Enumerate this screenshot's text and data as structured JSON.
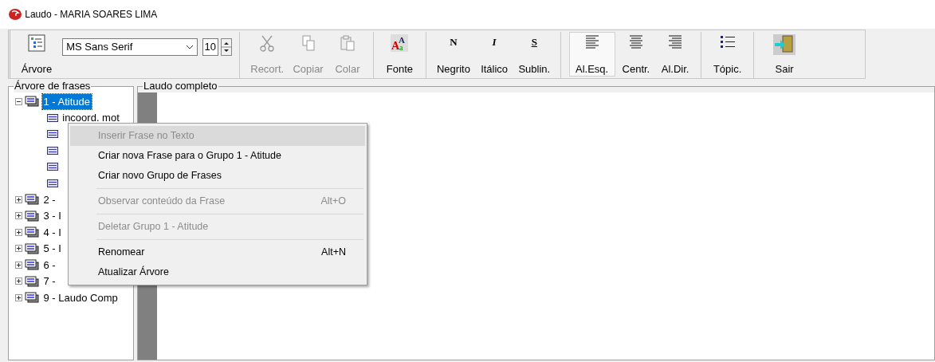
{
  "window": {
    "title": "Laudo - MARIA SOARES LIMA"
  },
  "toolbar": {
    "items": [
      {
        "kind": "button",
        "label": "Árvore"
      },
      {
        "kind": "font",
        "value": "MS Sans Serif",
        "size": "10"
      },
      {
        "kind": "separator"
      },
      {
        "kind": "button",
        "label": "Recort.",
        "disabled": true
      },
      {
        "kind": "button",
        "label": "Copiar",
        "disabled": true
      },
      {
        "kind": "button",
        "label": "Colar",
        "disabled": true
      },
      {
        "kind": "separator"
      },
      {
        "kind": "button",
        "label": "Fonte",
        "icon_glyphs": [
          "A",
          "A",
          "a"
        ]
      },
      {
        "kind": "separator"
      },
      {
        "kind": "button",
        "label": "Negrito",
        "glyph": "N"
      },
      {
        "kind": "button",
        "label": "Itálico",
        "glyph": "I"
      },
      {
        "kind": "button",
        "label": "Sublin.",
        "glyph": "S"
      },
      {
        "kind": "separator"
      },
      {
        "kind": "button",
        "label": "Al.Esq.",
        "selected": true
      },
      {
        "kind": "button",
        "label": "Centr.",
        "selected": false
      },
      {
        "kind": "button",
        "label": "Al.Dir.",
        "selected": false
      },
      {
        "kind": "separator"
      },
      {
        "kind": "button",
        "label": "Tópic."
      },
      {
        "kind": "separator"
      },
      {
        "kind": "button",
        "label": "Sair"
      }
    ]
  },
  "tree_panel": {
    "title": "Árvore de frases",
    "nodes": [
      {
        "label": "1 - Atitude",
        "expanded": true,
        "selected": true,
        "children": [
          {
            "kind": "phrase",
            "label": "incoord. mot"
          },
          {
            "kind": "phrase"
          },
          {
            "kind": "phrase"
          },
          {
            "kind": "phrase"
          },
          {
            "kind": "phrase"
          }
        ]
      },
      {
        "label": "2 -",
        "expanded": false,
        "selected": false
      },
      {
        "label": "3 - I",
        "expanded": false,
        "selected": false
      },
      {
        "label": "4 - I",
        "expanded": false,
        "selected": false
      },
      {
        "label": "5 - I",
        "expanded": false,
        "selected": false
      },
      {
        "label": "6 -",
        "expanded": false,
        "selected": false
      },
      {
        "label": "7 -",
        "expanded": false,
        "selected": false
      },
      {
        "label": "9 - Laudo Comp",
        "expanded": false,
        "selected": false
      }
    ]
  },
  "report_panel": {
    "title": "Laudo completo"
  },
  "context_menu": {
    "items": [
      {
        "kind": "item",
        "label": "Inserir Frase no Texto",
        "disabled": true,
        "highlighted": true
      },
      {
        "kind": "item",
        "label": "Criar nova Frase para o Grupo 1 - Atitude",
        "disabled": false,
        "highlighted": false
      },
      {
        "kind": "item",
        "label": "Criar novo Grupo de Frases",
        "disabled": false,
        "highlighted": false
      },
      {
        "kind": "separator"
      },
      {
        "kind": "item",
        "label": "Observar conteúdo da Frase",
        "shortcut": "Alt+O",
        "disabled": true,
        "highlighted": false
      },
      {
        "kind": "separator"
      },
      {
        "kind": "item",
        "label": "Deletar Grupo 1 - Atitude",
        "disabled": true,
        "highlighted": false
      },
      {
        "kind": "separator"
      },
      {
        "kind": "item",
        "label": "Renomear",
        "shortcut": "Alt+N",
        "disabled": false,
        "highlighted": false
      },
      {
        "kind": "item",
        "label": "Atualizar Árvore",
        "disabled": false,
        "highlighted": false
      }
    ]
  }
}
